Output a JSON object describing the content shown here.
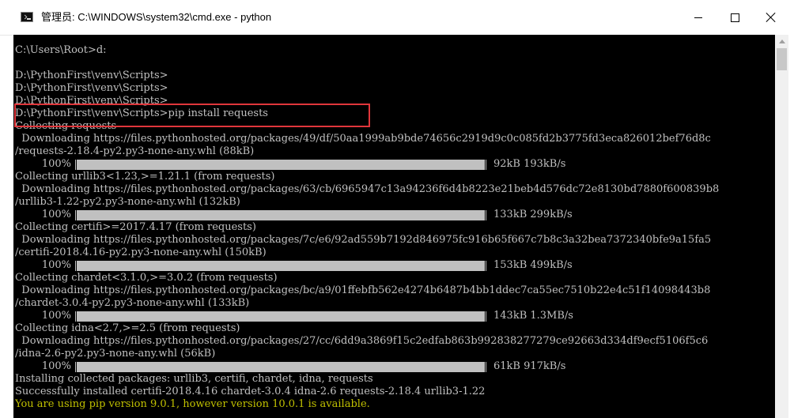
{
  "window": {
    "title": "管理员: C:\\WINDOWS\\system32\\cmd.exe - python",
    "icon": "cmd-icon"
  },
  "console": {
    "lines": [
      {
        "text": "C:\\Users\\Root>d:"
      },
      {
        "text": ""
      },
      {
        "text": "D:\\PythonFirst\\venv\\Scripts>"
      },
      {
        "text": "D:\\PythonFirst\\venv\\Scripts>"
      },
      {
        "text": "D:\\PythonFirst\\venv\\Scripts>"
      },
      {
        "text": "D:\\PythonFirst\\venv\\Scripts>pip install requests"
      },
      {
        "text": "Collecting requests"
      },
      {
        "text": "  Downloading https://files.pythonhosted.org/packages/49/df/50aa1999ab9bde74656c2919d9c0c085fd2b3775fd3eca826012bef76d8c"
      },
      {
        "text": "/requests-2.18.4-py2.py3-none-any.whl (88kB)"
      },
      {
        "progress": {
          "percent": "100%",
          "fraction": 1.0,
          "stats": "92kB 193kB/s"
        }
      },
      {
        "text": "Collecting urllib3<1.23,>=1.21.1 (from requests)"
      },
      {
        "text": "  Downloading https://files.pythonhosted.org/packages/63/cb/6965947c13a94236f6d4b8223e21beb4d576dc72e8130bd7880f600839b8"
      },
      {
        "text": "/urllib3-1.22-py2.py3-none-any.whl (132kB)"
      },
      {
        "progress": {
          "percent": "100%",
          "fraction": 1.0,
          "stats": "133kB 299kB/s"
        }
      },
      {
        "text": "Collecting certifi>=2017.4.17 (from requests)"
      },
      {
        "text": "  Downloading https://files.pythonhosted.org/packages/7c/e6/92ad559b7192d846975fc916b65f667c7b8c3a32bea7372340bfe9a15fa5"
      },
      {
        "text": "/certifi-2018.4.16-py2.py3-none-any.whl (150kB)"
      },
      {
        "progress": {
          "percent": "100%",
          "fraction": 1.0,
          "stats": "153kB 499kB/s"
        }
      },
      {
        "text": "Collecting chardet<3.1.0,>=3.0.2 (from requests)"
      },
      {
        "text": "  Downloading https://files.pythonhosted.org/packages/bc/a9/01ffebfb562e4274b6487b4bb1ddec7ca55ec7510b22e4c51f14098443b8"
      },
      {
        "text": "/chardet-3.0.4-py2.py3-none-any.whl (133kB)"
      },
      {
        "progress": {
          "percent": "100%",
          "fraction": 1.0,
          "stats": "143kB 1.3MB/s"
        }
      },
      {
        "text": "Collecting idna<2.7,>=2.5 (from requests)"
      },
      {
        "text": "  Downloading https://files.pythonhosted.org/packages/27/cc/6dd9a3869f15c2edfab863b992838277279ce92663d334df9ecf5106f5c6"
      },
      {
        "text": "/idna-2.6-py2.py3-none-any.whl (56kB)"
      },
      {
        "progress": {
          "percent": "100%",
          "fraction": 1.0,
          "stats": "61kB 917kB/s"
        }
      },
      {
        "text": "Installing collected packages: urllib3, certifi, chardet, idna, requests"
      },
      {
        "text": "Successfully installed certifi-2018.4.16 chardet-3.0.4 idna-2.6 requests-2.18.4 urllib3-1.22"
      },
      {
        "text": "You are using pip version 9.0.1, however version 10.0.1 is available.",
        "style": "warning"
      }
    ]
  },
  "colors": {
    "console_bg": "#000000",
    "console_text": "#c0c0c0",
    "warning_text": "#c0c000",
    "highlight_border": "#e0363b"
  }
}
